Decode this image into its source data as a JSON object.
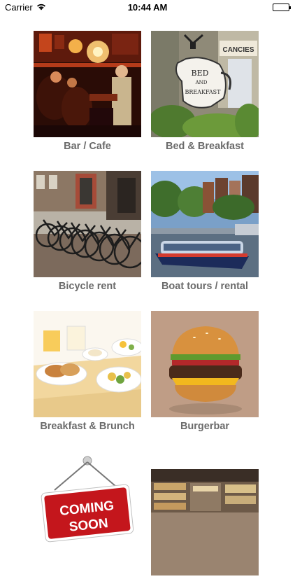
{
  "status_bar": {
    "carrier": "Carrier",
    "time": "10:44 AM"
  },
  "categories": [
    {
      "label": "Bar / Cafe"
    },
    {
      "label": "Bed & Breakfast"
    },
    {
      "label": "Bicycle rent"
    },
    {
      "label": "Boat tours / rental"
    },
    {
      "label": "Breakfast & Brunch"
    },
    {
      "label": "Burgerbar"
    },
    {
      "label": ""
    },
    {
      "label": ""
    }
  ],
  "images": {
    "bed_sign_text_1": "BED",
    "bed_sign_text_2": "AND",
    "bed_sign_text_3": "BREAKFAST",
    "bed_board_text": "CANCIES",
    "coming_soon_text_1": "COMING",
    "coming_soon_text_2": "SOON"
  }
}
